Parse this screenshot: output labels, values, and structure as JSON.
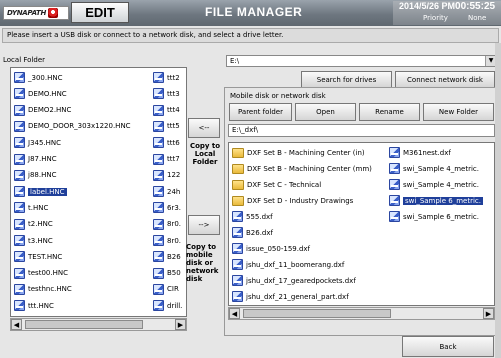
{
  "header": {
    "logo_text": "DYNAPATH",
    "mode_label": "EDIT",
    "app_title": "FILE MANAGER",
    "date": "2014/5/26 PM",
    "time": "00:55:25",
    "priority_label": "Priority",
    "priority_value": "None"
  },
  "instruction": "Please insert a USB disk or connect to a network disk, and select a drive letter.",
  "local": {
    "label": "Local Folder",
    "col1": [
      {
        "name": "_300.HNC",
        "selected": false
      },
      {
        "name": "DEMO.HNC",
        "selected": false
      },
      {
        "name": "DEMO2.HNC",
        "selected": false
      },
      {
        "name": "DEMO_DOOR_303x1220.HNC",
        "selected": false
      },
      {
        "name": "J345.HNC",
        "selected": false
      },
      {
        "name": "J87.HNC",
        "selected": false
      },
      {
        "name": "j88.HNC",
        "selected": false
      },
      {
        "name": "label.HNC",
        "selected": true
      },
      {
        "name": "t.HNC",
        "selected": false
      },
      {
        "name": "t2.HNC",
        "selected": false
      },
      {
        "name": "t3.HNC",
        "selected": false
      },
      {
        "name": "TEST.HNC",
        "selected": false
      },
      {
        "name": "test00.HNC",
        "selected": false
      },
      {
        "name": "testhnc.HNC",
        "selected": false
      },
      {
        "name": "ttt.HNC",
        "selected": false
      }
    ],
    "col2": [
      "ttt2",
      "ttt3",
      "ttt4",
      "ttt5",
      "ttt6",
      "ttt7",
      "122",
      "24h",
      "6r3.",
      "8r0.",
      "8r0.",
      "B26",
      "B50",
      "CIR",
      "drill."
    ]
  },
  "transfer": {
    "copy_left_arrow": "<--",
    "copy_to_local_label": "Copy to Local Folder",
    "copy_right_arrow": "-->",
    "copy_to_mobile_label": "Copy to mobile disk or network disk"
  },
  "drive": {
    "value": "E:\\",
    "search_label": "Search for drives",
    "connect_label": "Connect network disk"
  },
  "mobile": {
    "label": "Mobile disk or network disk",
    "buttons": [
      "Parent folder",
      "Open",
      "Rename",
      "New Folder"
    ],
    "path": "E:\\_dxf\\",
    "col1": [
      {
        "name": "DXF Set B - Machining Center (in)",
        "type": "folder",
        "selected": false
      },
      {
        "name": "DXF Set B - Machining Center (mm)",
        "type": "folder",
        "selected": false
      },
      {
        "name": "DXF Set C - Technical",
        "type": "folder",
        "selected": false
      },
      {
        "name": "DXF Set D - Industry Drawings",
        "type": "folder",
        "selected": false
      },
      {
        "name": "555.dxf",
        "type": "file",
        "selected": false
      },
      {
        "name": "B26.dxf",
        "type": "file",
        "selected": false
      },
      {
        "name": "issue_050-159.dxf",
        "type": "file",
        "selected": false
      },
      {
        "name": "jshu_dxf_11_boomerang.dxf",
        "type": "file",
        "selected": false
      },
      {
        "name": "jshu_dxf_17_gearedpockets.dxf",
        "type": "file",
        "selected": false
      },
      {
        "name": "jshu_dxf_21_general_part.dxf",
        "type": "file",
        "selected": false
      }
    ],
    "col2": [
      {
        "name": "M361nest.dxf",
        "selected": false
      },
      {
        "name": "swi_Sample 4_metric.",
        "selected": false
      },
      {
        "name": "swi_Sample 4_metric.",
        "selected": false
      },
      {
        "name": "swi_Sample 6_metric.",
        "selected": true
      },
      {
        "name": "swi_Sample 6_metric.",
        "selected": false
      }
    ]
  },
  "back_label": "Back"
}
